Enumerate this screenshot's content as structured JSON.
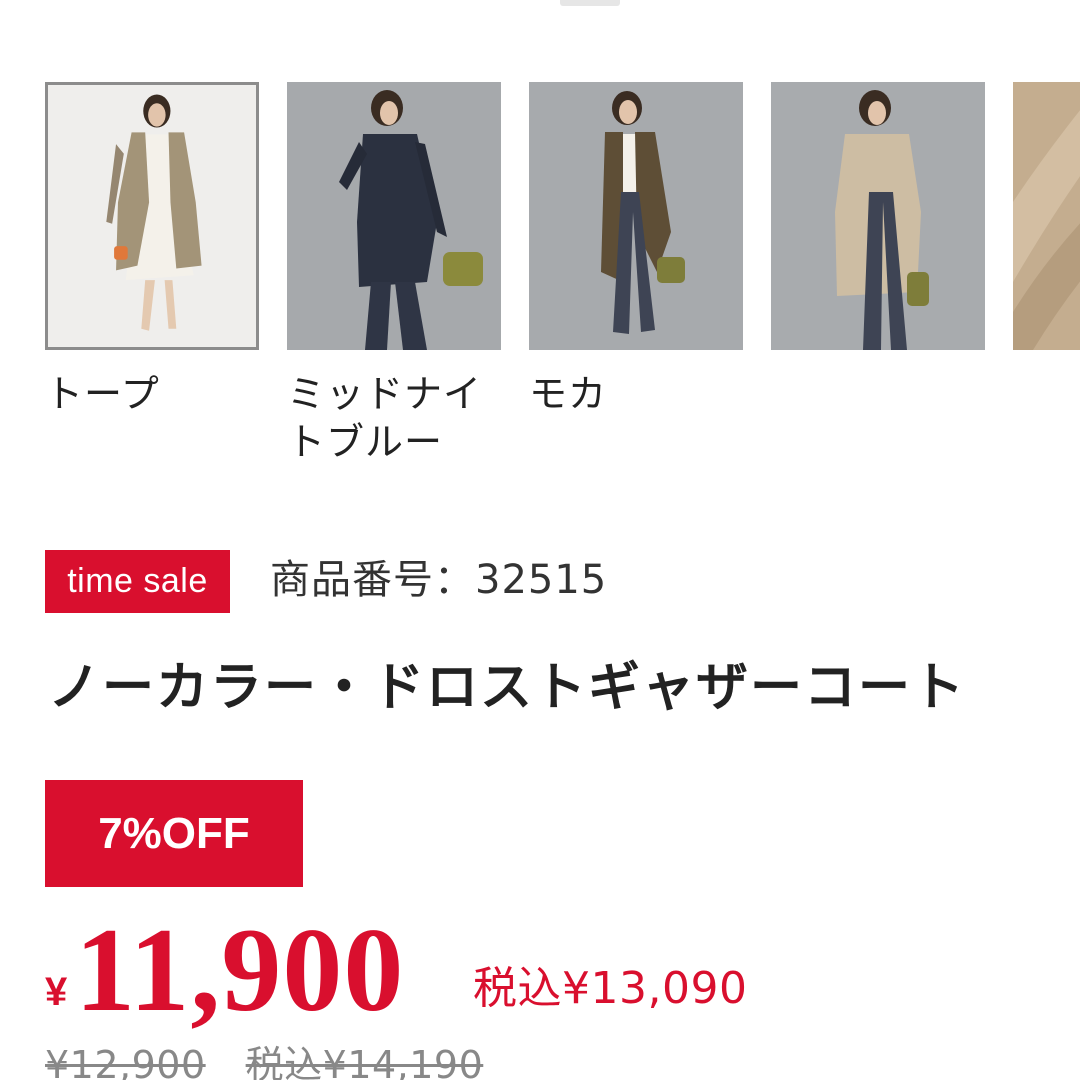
{
  "colors": {
    "accent": "#d90f2e",
    "text": "#222222",
    "muted": "#888888"
  },
  "swatches": [
    {
      "label": "トープ",
      "selected": true,
      "coat_color": "#a39478",
      "image": "model-in-taupe-coat"
    },
    {
      "label": "ミッドナイトブルー",
      "selected": false,
      "coat_color": "#2b3140",
      "image": "model-in-midnight-blue-coat"
    },
    {
      "label": "モカ",
      "selected": false,
      "coat_color": "#5e4e36",
      "image": "model-in-mocha-coat"
    },
    {
      "label": "",
      "selected": false,
      "coat_color": "#cdbda3",
      "image": "model-in-beige-coat"
    },
    {
      "label": "",
      "selected": false,
      "coat_color": "#c4ad8f",
      "image": "fabric-closeup"
    }
  ],
  "product": {
    "badge": "time sale",
    "number": "商品番号：32515",
    "title": "ノーカラー・ドロストギャザーコート",
    "discount": "7%OFF",
    "price_symbol": "¥",
    "price": "11,900",
    "price_tax_incl": "税込¥13,090",
    "original_price": "¥12,900",
    "original_price_tax_incl": "税込¥14,190"
  }
}
